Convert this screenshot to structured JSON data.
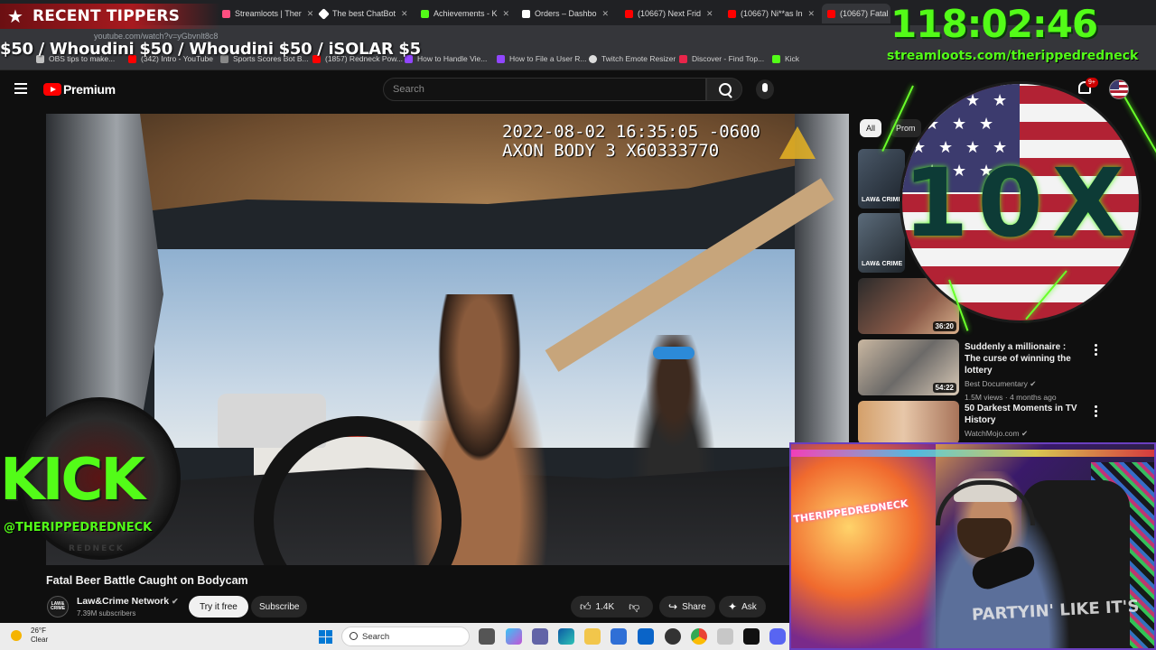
{
  "browser": {
    "tabs": [
      {
        "label": "Streamloots | Ther",
        "color": "#ff4f81"
      },
      {
        "label": "The best ChatBot",
        "color": "#ffffff"
      },
      {
        "label": "Achievements - K",
        "color": "#53fc18"
      },
      {
        "label": "Orders – Dashbo",
        "color": "#ffffff"
      },
      {
        "label": "(10667) Next Frid",
        "color": "#ff0000"
      },
      {
        "label": "(10667) Ni**as In",
        "color": "#ff0000"
      },
      {
        "label": "(10667) Fatal Be",
        "color": "#ff0000"
      }
    ],
    "url": "youtube.com/watch?v=yGbvnlt8c8",
    "bookmarks": [
      {
        "label": "OBS tips to make...",
        "color": "#c0c0c0"
      },
      {
        "label": "(342) Intro - YouTube",
        "color": "#ff0000"
      },
      {
        "label": "Sports Scores Bot B...",
        "color": "#888888"
      },
      {
        "label": "(1857) Redneck Pow...",
        "color": "#ff0000"
      },
      {
        "label": "How to Handle Vie...",
        "color": "#9146ff"
      },
      {
        "label": "How to File a User R...",
        "color": "#9146ff"
      },
      {
        "label": "Twitch Emote Resizer",
        "color": "#dddddd"
      },
      {
        "label": "Discover - Find Top...",
        "color": "#e8254a"
      },
      {
        "label": "Kick",
        "color": "#53fc18"
      }
    ]
  },
  "overlay": {
    "recent_tippers_title": "RECENT TIPPERS",
    "ticker": "$50 / Whoudini $50 / Whoudini $50 / iSOLAR $5",
    "timer": "118:02:46",
    "streamloots_url": "streamloots.com/therippedredneck",
    "kick_word": "KICK",
    "kick_handle": "@THERIPPEDREDNECK",
    "kick_sub": "REDNECK",
    "tenx": "10X",
    "kick_color": "#53fc18"
  },
  "youtube": {
    "brand": "Premium",
    "search_placeholder": "Search",
    "notification_count": "9+",
    "chips": [
      "All",
      "Prom"
    ],
    "video": {
      "timestamp_line1": "2022-08-02 16:35:05 -0600",
      "timestamp_line2": "AXON BODY 3 X60333770",
      "title": "Fatal Beer Battle Caught on Bodycam",
      "channel": "Law&Crime Network",
      "channel_avatar": "LAW& CRIME",
      "subscribers": "7.39M subscribers",
      "try_free": "Try it free",
      "subscribe": "Subscribe",
      "likes": "1.4K",
      "share": "Share",
      "ask": "Ask"
    },
    "recommendations": [
      {
        "thumb_label": "LAW& CRIME",
        "duration": ""
      },
      {
        "thumb_label": "LAW& CRIME",
        "duration": ""
      },
      {
        "thumb_label": "",
        "duration": "36:20"
      },
      {
        "title": "Suddenly a millionaire : The curse of winning the lottery",
        "channel": "Best Documentary",
        "meta": "1.5M views · 4 months ago",
        "duration": "54:22"
      },
      {
        "title": "50 Darkest Moments in TV History",
        "channel": "WatchMojo.com",
        "meta": "",
        "duration": ""
      }
    ]
  },
  "webcam": {
    "shirt_text": "PARTYIN' LIKE IT'S",
    "sign_text": "THERIPPEDREDNECK"
  },
  "taskbar": {
    "temperature": "26°F",
    "condition": "Clear",
    "search_label": "Search"
  }
}
